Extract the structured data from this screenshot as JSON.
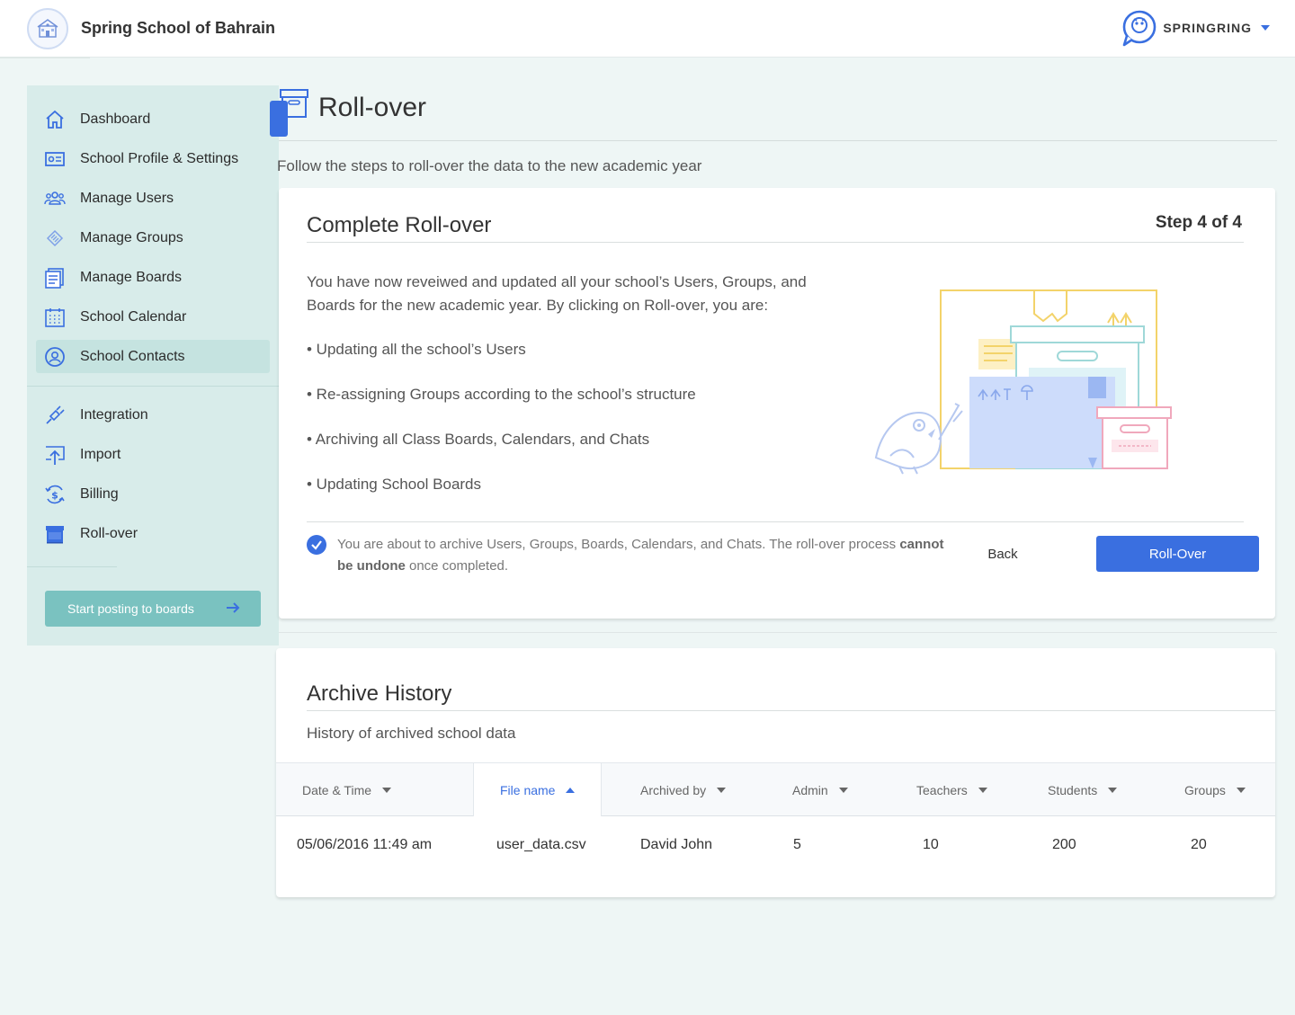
{
  "header": {
    "school_name": "Spring School of Bahrain",
    "brand_name": "SPRINGRING"
  },
  "sidebar": {
    "items": [
      {
        "label": "Dashboard",
        "icon": "home-icon"
      },
      {
        "label": "School Profile & Settings",
        "icon": "id-card-icon"
      },
      {
        "label": "Manage Users",
        "icon": "users-icon"
      },
      {
        "label": "Manage Groups",
        "icon": "groups-icon"
      },
      {
        "label": "Manage Boards",
        "icon": "boards-icon"
      },
      {
        "label": "School Calendar",
        "icon": "calendar-icon"
      },
      {
        "label": "School Contacts",
        "icon": "contacts-icon"
      },
      {
        "label": "Integration",
        "icon": "plug-icon"
      },
      {
        "label": "Import",
        "icon": "import-icon"
      },
      {
        "label": "Billing",
        "icon": "billing-icon"
      },
      {
        "label": "Roll-over",
        "icon": "rollover-icon"
      }
    ],
    "active_item": "School Contacts",
    "cta_label": "Start posting to boards"
  },
  "page": {
    "title": "Roll-over",
    "subtitle": "Follow the steps to roll-over the data to the new academic year"
  },
  "rollover_card": {
    "title": "Complete Roll-over",
    "step": "Step 4 of 4",
    "intro": "You have now reveiwed and updated all your school’s Users, Groups, and Boards for the new academic year. By clicking on Roll-over, you are:",
    "bullets": [
      "• Updating all the school’s Users",
      "• Re-assigning Groups according to the school’s structure",
      "• Archiving all Class Boards, Calendars, and Chats",
      "• Updating School Boards"
    ],
    "warning_pre": "You are about to archive Users, Groups, Boards, Calendars, and Chats. The roll-over process ",
    "warning_bold": "cannot be undone",
    "warning_post": " once completed.",
    "confirm_checked": true,
    "back_label": "Back",
    "rollover_label": "Roll-Over"
  },
  "archive": {
    "title": "Archive History",
    "subtitle": "History of archived school data",
    "columns": [
      "Date & Time",
      "File name",
      "Archived by",
      "Admin",
      "Teachers",
      "Students",
      "Groups"
    ],
    "sorted_column": "File name",
    "rows": [
      [
        "05/06/2016 11:49 am",
        "user_data.csv",
        "David John",
        "5",
        "10",
        "200",
        "20"
      ]
    ]
  },
  "colors": {
    "accent": "#3a6fe0",
    "sidebar_bg": "#d8ecea",
    "cta_bg": "#7ac2c0",
    "page_bg": "#eef6f5"
  }
}
